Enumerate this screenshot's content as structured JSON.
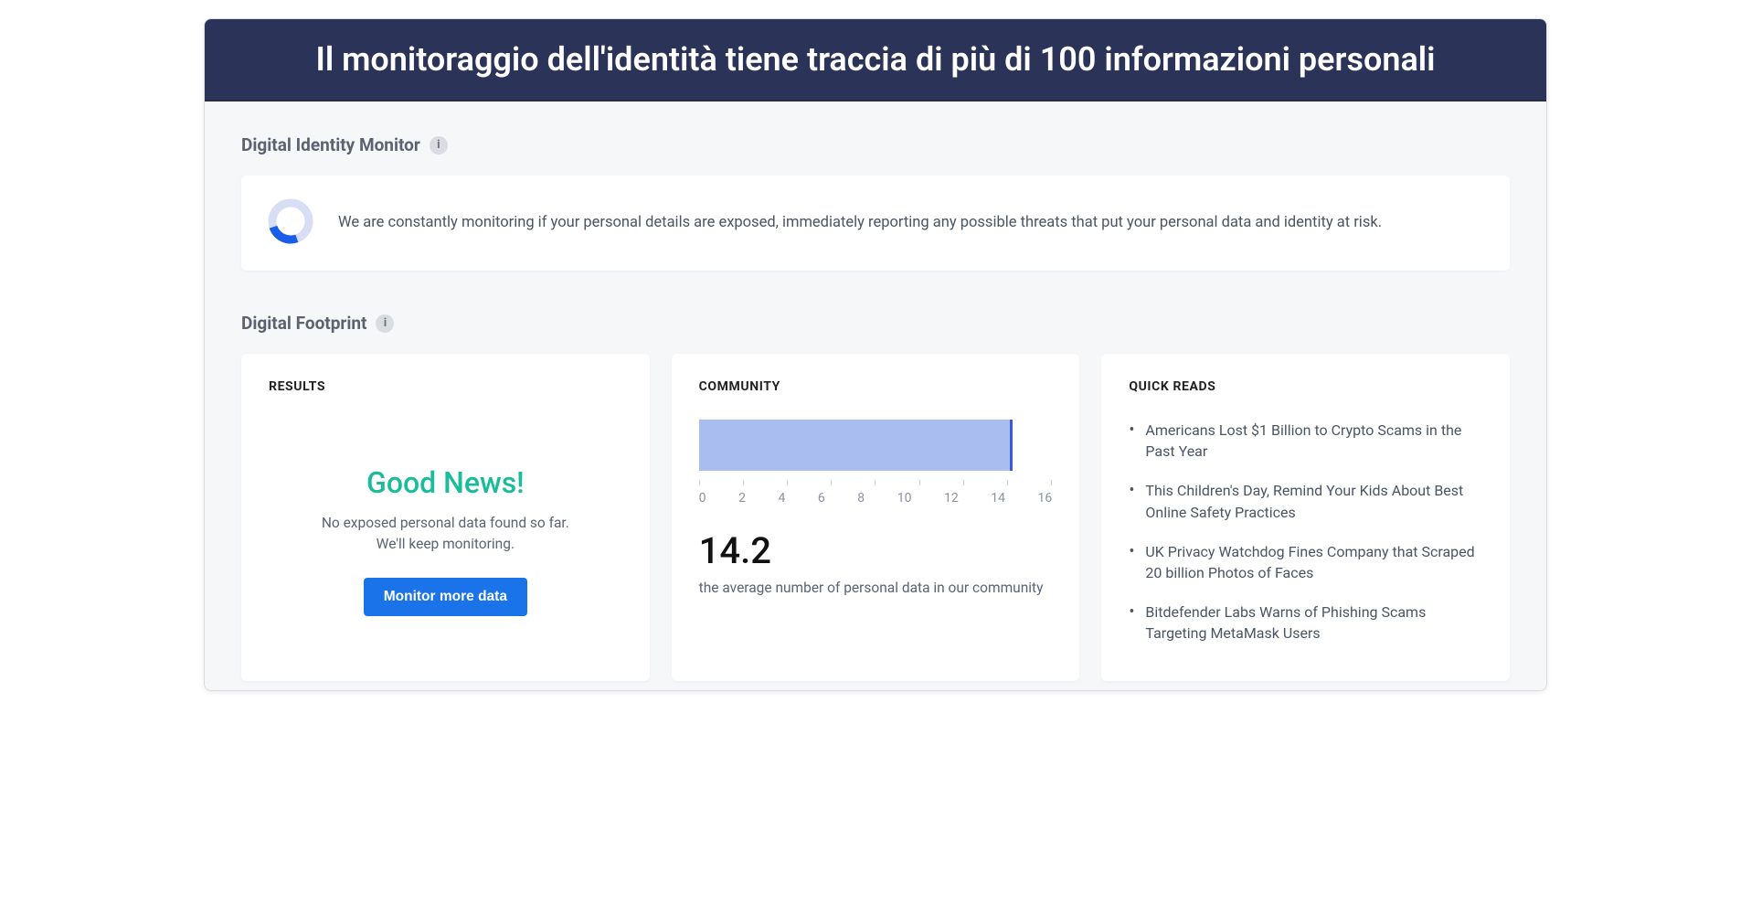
{
  "banner": "Il monitoraggio dell'identità tiene traccia di più di 100 informazioni personali",
  "identity_monitor": {
    "section_title": "Digital Identity Monitor",
    "description": "We are constantly monitoring if your personal details are exposed, immediately reporting any possible threats that put your personal data and identity at risk."
  },
  "footprint": {
    "section_title": "Digital Footprint",
    "results": {
      "title": "RESULTS",
      "headline": "Good News!",
      "line1": "No exposed personal data found so far.",
      "line2": "We'll keep monitoring.",
      "button_label": "Monitor more data"
    },
    "community": {
      "title": "COMMUNITY",
      "stat_value": "14.2",
      "stat_caption": "the average number of personal data in our community"
    },
    "quick_reads": {
      "title": "QUICK READS",
      "items": [
        "Americans Lost $1 Billion to Crypto Scams in the Past Year",
        "This Children's Day, Remind Your Kids About Best Online Safety Practices",
        "UK Privacy Watchdog Fines Company that Scraped 20 billion Photos of Faces",
        "Bitdefender Labs Warns of Phishing Scams Targeting MetaMask Users"
      ]
    }
  },
  "chart_data": {
    "type": "bar",
    "orientation": "horizontal",
    "x": [
      14.2
    ],
    "categories": [
      ""
    ],
    "title": "",
    "xlabel": "",
    "ylabel": "",
    "xlim": [
      0,
      16
    ],
    "xticks": [
      0,
      2,
      4,
      6,
      8,
      10,
      12,
      14,
      16
    ],
    "bar_color": "#a9bdf0",
    "edge_right_color": "#3b5bd6"
  }
}
